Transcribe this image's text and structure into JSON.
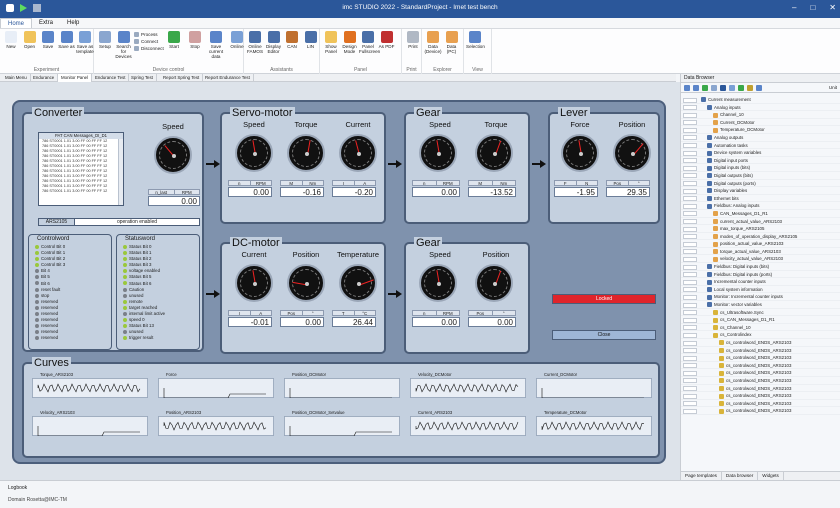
{
  "title": "imc STUDIO 2022 - StandardProject - Imet test bench",
  "menu": [
    "Home",
    "Extra",
    "Help"
  ],
  "ribbon": {
    "experiment": {
      "label": "Experiment",
      "buttons": [
        "New",
        "Open",
        "Save",
        "Save as",
        "Save as template"
      ]
    },
    "device": {
      "label": "Device control",
      "buttons": [
        "Setup",
        "Search for Devices",
        "Start",
        "Stop",
        "Save current data",
        "Online"
      ],
      "small": [
        "Process",
        "Connect",
        "Disconnect"
      ]
    },
    "assistants": {
      "label": "Assistants",
      "buttons": [
        "Online FAMOS",
        "Display Editor",
        "CAN",
        "LIN"
      ]
    },
    "panel": {
      "label": "Panel",
      "buttons": [
        "Show Panel",
        "Design Mode",
        "Panel Fullscreen",
        "As PDF"
      ]
    },
    "print": {
      "label": "Print",
      "buttons": [
        "Print"
      ]
    },
    "explorer": {
      "label": "Explorer",
      "buttons": [
        "Data (Device)",
        "Data (PC)"
      ]
    },
    "view": {
      "label": "View",
      "buttons": [
        "Selection"
      ]
    }
  },
  "tabs": [
    "Main Menu",
    "Endurance",
    "Monitor Panel",
    "Endurance Test",
    "Spring Test",
    "Report Spring Test",
    "Report Endurance Test"
  ],
  "converter": {
    "title": "Converter",
    "speed_label": "Speed",
    "units": [
      "n_last",
      "RPM"
    ],
    "value": "0.00",
    "trace_title": "PAT CAN Messages_DI_D1",
    "trace_lines": [
      "786 ST0001 1.01 3.00 FF 00 FF FF 12",
      "786 ST0001 1.01 3.00 FF 00 FF FF 12",
      "786 ST0001 1.01 3.00 FF 00 FF FF 12",
      "786 ST0001 1.01 3.00 FF 00 FF FF 12",
      "786 ST0001 1.01 3.00 FF 00 FF FF 12",
      "786 ST0001 1.01 3.00 FF 00 FF FF 12",
      "786 ST0001 1.01 3.00 FF 00 FF FF 12",
      "786 ST0001 1.01 3.00 FF 00 FF FF 12",
      "786 ST0001 1.01 3.00 FF 00 FF FF 12",
      "786 ST0001 1.01 3.00 FF 00 FF FF 12",
      "786 ST0001 1.01 3.00 FF 00 FF FF 12"
    ],
    "status_id": "ARS2105",
    "status_text": "operation enabled",
    "controlword_title": "Controlword",
    "controlword": [
      "Control Bit 0",
      "Control Bit 1",
      "Control Bit 2",
      "Control Bit 3",
      "Bit 4",
      "Bit 5",
      "Bit 6",
      "reset fault",
      "stop",
      "reserved",
      "reserved",
      "reserved",
      "reserved",
      "reserved",
      "reserved",
      "reserved"
    ],
    "statusword_title": "Statusword",
    "statusword": [
      "Status Bit 0",
      "Status Bit 1",
      "Status Bit 2",
      "Status Bit 3",
      "voltage enabled",
      "Status Bit 5",
      "Status Bit 6",
      "Caution",
      "unused",
      "remote",
      "target reached",
      "internal limit active",
      "speed 0",
      "Status Bit 13",
      "unused",
      "trigger result"
    ]
  },
  "servo": {
    "title": "Servo-motor",
    "cols": [
      {
        "label": "Speed",
        "units": [
          "n",
          "RPM"
        ],
        "value": "0.00"
      },
      {
        "label": "Torque",
        "units": [
          "M",
          "Nm"
        ],
        "value": "-0.16"
      },
      {
        "label": "Current",
        "units": [
          "I",
          "A"
        ],
        "value": "-0.20"
      }
    ]
  },
  "gear1": {
    "title": "Gear",
    "cols": [
      {
        "label": "Speed",
        "units": [
          "n",
          "RPM"
        ],
        "value": "0.00"
      },
      {
        "label": "Torque",
        "units": [
          "M",
          "Nm"
        ],
        "value": "-13.52"
      }
    ]
  },
  "lever": {
    "title": "Lever",
    "cols": [
      {
        "label": "Force",
        "units": [
          "F",
          "N"
        ],
        "value": "-1.95"
      },
      {
        "label": "Position",
        "units": [
          "Pos",
          "°"
        ],
        "value": "29.35"
      }
    ],
    "locked": "Locked",
    "close": "Close"
  },
  "dcmotor": {
    "title": "DC-motor",
    "cols": [
      {
        "label": "Current",
        "units": [
          "I",
          "A"
        ],
        "value": "-0.01"
      },
      {
        "label": "Position",
        "units": [
          "Pos",
          "°"
        ],
        "value": "0.00"
      },
      {
        "label": "Temperature",
        "units": [
          "T",
          "°C"
        ],
        "value": "26.44"
      }
    ]
  },
  "gear2": {
    "title": "Gear",
    "cols": [
      {
        "label": "Speed",
        "units": [
          "n",
          "RPM"
        ],
        "value": "0.00"
      },
      {
        "label": "Position",
        "units": [
          "Pos",
          "°"
        ],
        "value": "0.00"
      }
    ]
  },
  "curves": {
    "title": "Curves",
    "items": [
      "Torque_ARS2103",
      "Force",
      "Position_DCMotor",
      "Velocity_DCMotor",
      "Current_DCMotor",
      "Velocity_ARS2103",
      "Position_ARS2103",
      "Position_DCMotor_Setvalue",
      "Current_ARS2103",
      "Temperature_DCMotor"
    ]
  },
  "sidebar": {
    "title": "Data Browser",
    "col": "Unit",
    "tree": [
      "Current measurement",
      "Analog inputs",
      "Channel_10",
      "Current_DCMotor",
      "Temperature_DCMotor",
      "Analog outputs",
      "Automation tasks",
      "Device system variables",
      "Digital input ports",
      "Digital inputs (bits)",
      "Digital outputs (bits)",
      "Digital outputs (ports)",
      "Display variables",
      "Ethernet bits",
      "Fieldbus: Analog inputs",
      "CAN_Messages_D1_R1",
      "current_actual_value_ARS2103",
      "max_torque_ARS2105",
      "modes_of_operation_display_ARS2105",
      "position_actual_value_ARS2103",
      "torque_actual_value_ARS2103",
      "velocity_actual_value_ARS2103",
      "Fieldbus: Digital inputs (bits)",
      "Fieldbus: Digital inputs (ports)",
      "Incremental counter inputs",
      "Local system information",
      "Monitor: Incremental counter inputs",
      "Monitor: vector variables",
      "cs_Ultrasoftware.Sync",
      "cs_CAN_Messages_D1_R1",
      "cs_Channel_10",
      "cs_Controlindex",
      "cs_controlword_ENDS_ARS2103",
      "cs_controlword_ENDS_ARS2103",
      "cs_controlword_ENDS_ARS2103",
      "cs_controlword_ENDS_ARS2103",
      "cs_controlword_ENDS_ARS2103",
      "cs_controlword_ENDS_ARS2103",
      "cs_controlword_ENDS_ARS2103",
      "cs_controlword_ENDS_ARS2103",
      "cs_controlword_ENDS_ARS2103",
      "cs_controlword_ENDS_ARS2103"
    ],
    "bottom_tabs": [
      "Page templates",
      "Data browser",
      "Widgets"
    ]
  },
  "status": {
    "line1": "Logbook",
    "line2": "Domain Rosetta@IMC-TM"
  }
}
